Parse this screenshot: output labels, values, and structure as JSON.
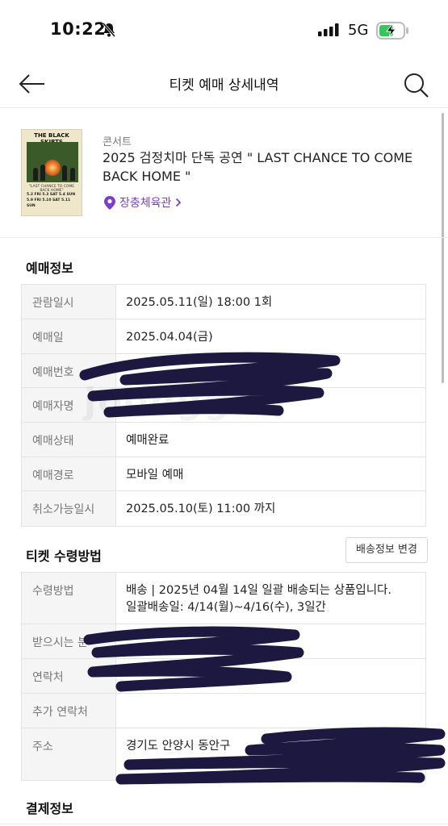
{
  "status_bar": {
    "time": "10:22",
    "network": "5G"
  },
  "header": {
    "title": "티켓 예매 상세내역"
  },
  "product": {
    "category": "콘서트",
    "title": "2025 검정치마 단독 공연 \" LAST CHANCE TO COME BACK HOME \"",
    "venue": "장충체육관",
    "poster": {
      "title": "THE BLACK SKIRTS",
      "subtitle": "\"LAST CHANCE TO COME BACK HOME\"",
      "dates": [
        "5.2 FRI",
        "5.3 SAT",
        "5.4 SUN",
        "5.9 FRI",
        "5.10 SAT",
        "5.11 SUN"
      ]
    }
  },
  "booking_info": {
    "section_title": "예매정보",
    "rows": [
      {
        "label": "관람일시",
        "value": "2025.05.11(일) 18:00 1회"
      },
      {
        "label": "예매일",
        "value": "2025.04.04(금)"
      },
      {
        "label": "예매번호",
        "value": ""
      },
      {
        "label": "예매자명",
        "value": ""
      },
      {
        "label": "예매상태",
        "value": "예매완료"
      },
      {
        "label": "예매경로",
        "value": "모바일 예매"
      },
      {
        "label": "취소가능일시",
        "value": "2025.05.10(토) 11:00 까지"
      }
    ]
  },
  "ticket_receive": {
    "section_title": "티켓 수령방법",
    "change_button": "배송정보 변경",
    "rows": [
      {
        "label": "수령방법",
        "value": "배송 | 2025년 04월 14일 일괄 배송되는 상품입니다.",
        "value2": "일괄배송일: 4/14(월)~4/16(수), 3일간"
      },
      {
        "label": "받으시는 분",
        "value": ""
      },
      {
        "label": "연락처",
        "value": ""
      },
      {
        "label": "추가 연락처",
        "value": ""
      },
      {
        "label": "주소",
        "value": "경기도 안양시 동안구",
        "value2": ""
      }
    ]
  },
  "payment_info": {
    "section_title": "결제정보"
  },
  "watermark": "joonggo",
  "colors": {
    "accent": "#7a3fd1",
    "redaction": "#1c1840"
  }
}
